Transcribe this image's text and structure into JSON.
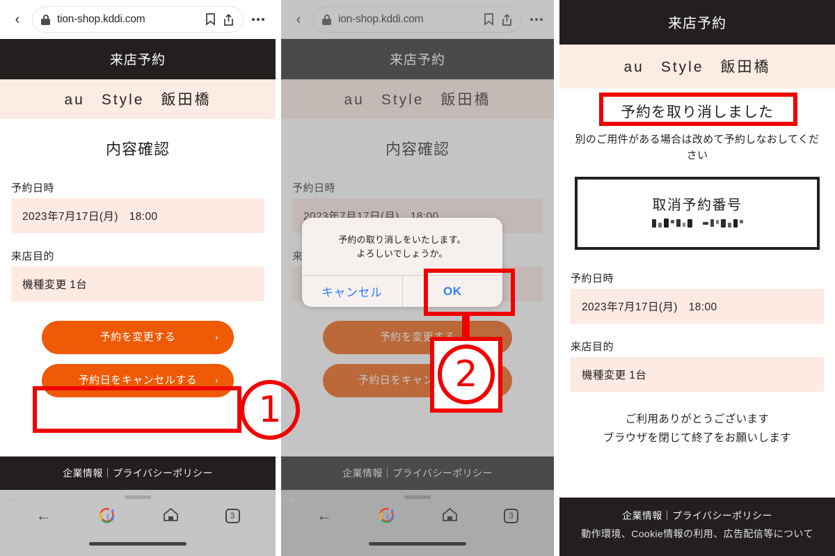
{
  "browser": {
    "url_faded_prefix": "tion-shop.kddi.com",
    "url_full": "tion-shop.kddi.com",
    "back_glyph": "‹",
    "menu_dots": "•••",
    "tab_count": "3"
  },
  "browser2": {
    "url_faded_prefix": "ion-shop.kddi.com"
  },
  "site": {
    "header_title": "来店予約",
    "store_name": "au　Style　飯田橋",
    "footer_line1": "企業情報｜プライバシーポリシー",
    "footer_line2": "動作環境、Cookie情報の利用、広告配信等について"
  },
  "panel1": {
    "page_title": "内容確認",
    "fields": [
      {
        "label": "予約日時",
        "value": "2023年7月17日(月)　18:00"
      },
      {
        "label": "来店目的",
        "value": "機種変更 1台"
      }
    ],
    "buttons": [
      {
        "label": "予約を変更する",
        "chevron": "›"
      },
      {
        "label": "予約日をキャンセルする",
        "chevron": "›"
      }
    ]
  },
  "panel2": {
    "page_title": "内容確認",
    "dialog": {
      "message_line1": "予約の取り消しをいたします。",
      "message_line2": "よろしいでしょうか。",
      "cancel_label": "キャンセル",
      "ok_label": "OK"
    }
  },
  "panel3": {
    "result_title": "予約を取り消しました",
    "notice": "別のご用件がある場合は改めて予約しなおしてください",
    "reservation_box_title": "取消予約番号",
    "reservation_number": "",
    "fields": [
      {
        "label": "予約日時",
        "value": "2023年7月17日(月)　18:00"
      },
      {
        "label": "来店目的",
        "value": "機種変更 1台"
      }
    ],
    "thanks_line1": "ご利用ありがとうございます",
    "thanks_line2": "ブラウザを閉じて終了をお願いします"
  },
  "annotations": {
    "step1": "①",
    "step2": "②"
  },
  "colors": {
    "accent_orange": "#EE5A06",
    "annotation_red": "#F00100",
    "band_pink": "#FDECE4",
    "field_pink": "#FDEAE3",
    "header_dark": "#231F1F",
    "dialog_blue": "#2D7EF7"
  }
}
